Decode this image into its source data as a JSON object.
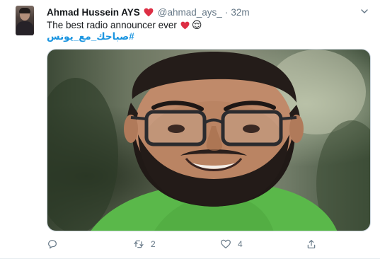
{
  "tweet": {
    "author_name": "Ahmad Hussein AYS",
    "handle": "@ahmad_ays_",
    "separator": "·",
    "timestamp": "32m",
    "text": "The best radio announcer ever",
    "emoji_relieved": "😌",
    "hashtag": "#صباحك_مع_يونس"
  },
  "actions": {
    "reply_count": "",
    "retweet_count": "2",
    "like_count": "4"
  },
  "colors": {
    "name": "#14171a",
    "secondary": "#657786",
    "link": "#1b95e0",
    "heart": "#e0245e"
  },
  "icons": [
    "chevron-down-icon",
    "heart-icon",
    "reply-icon",
    "retweet-icon",
    "like-icon",
    "share-icon"
  ]
}
